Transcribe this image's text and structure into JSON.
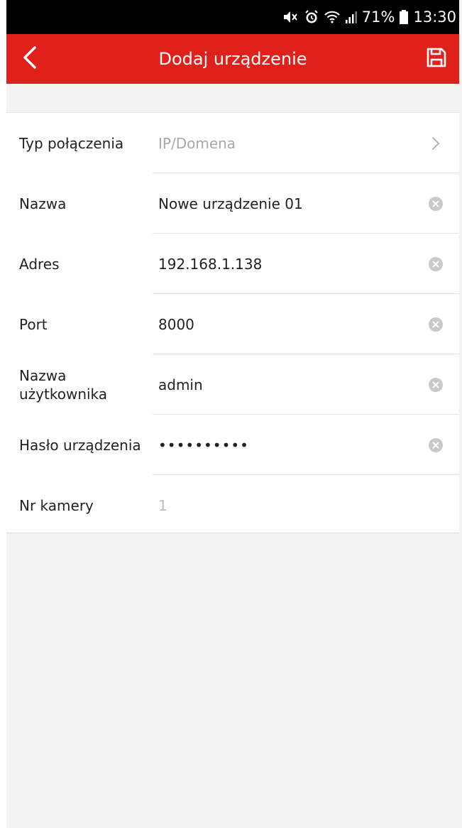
{
  "status_bar": {
    "battery_percent": "71%",
    "time": "13:30"
  },
  "header": {
    "title": "Dodaj urządzenie",
    "back_icon": "chevron-left-icon",
    "save_icon": "save-icon",
    "color": "#e0201b"
  },
  "form": {
    "rows": [
      {
        "label": "Typ połączenia",
        "value": "IP/Domena",
        "trailing": "chevron-right-icon"
      },
      {
        "label": "Nazwa",
        "value": "Nowe urządzenie 01",
        "trailing": "clear-icon"
      },
      {
        "label": "Adres",
        "value": "192.168.1.138",
        "trailing": "clear-icon"
      },
      {
        "label": "Port",
        "value": "8000",
        "trailing": "clear-icon"
      },
      {
        "label": "Nazwa\nużytkownika",
        "label_line1": "Nazwa",
        "label_line2": "użytkownika",
        "value": "admin",
        "trailing": "clear-icon"
      },
      {
        "label": "Hasło urządzenia",
        "value": "••••••••••",
        "trailing": "clear-icon"
      },
      {
        "label": "Nr kamery",
        "placeholder": "1"
      }
    ]
  }
}
